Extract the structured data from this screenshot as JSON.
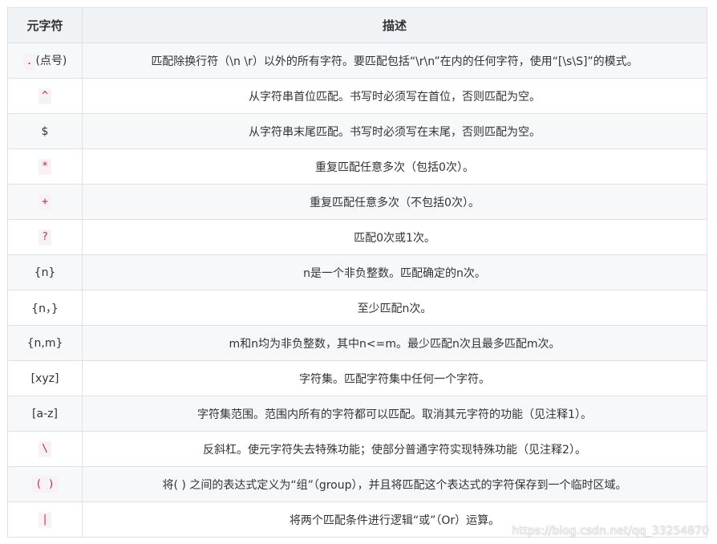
{
  "headers": {
    "col1": "元字符",
    "col2": "描述"
  },
  "rows": [
    {
      "symbol": ".",
      "symbol_suffix": "(点号)",
      "style": "code",
      "desc": "匹配除换行符（\\n \\r）以外的所有字符。要匹配包括“\\r\\n”在内的任何字符，使用“[\\s\\S]”的模式。"
    },
    {
      "symbol": "^",
      "symbol_suffix": "",
      "style": "code",
      "desc": "从字符串首位匹配。书写时必须写在首位，否则匹配为空。"
    },
    {
      "symbol": "$",
      "symbol_suffix": "",
      "style": "plain",
      "desc": "从字符串末尾匹配。书写时必须写在末尾，否则匹配为空。"
    },
    {
      "symbol": "*",
      "symbol_suffix": "",
      "style": "code",
      "desc": "重复匹配任意多次（包括0次）。"
    },
    {
      "symbol": "+",
      "symbol_suffix": "",
      "style": "code",
      "desc": "重复匹配任意多次（不包括0次）。"
    },
    {
      "symbol": "?",
      "symbol_suffix": "",
      "style": "code",
      "desc": "匹配0次或1次。"
    },
    {
      "symbol": "{n}",
      "symbol_suffix": "",
      "style": "plain",
      "desc": "n是一个非负整数。匹配确定的n次。"
    },
    {
      "symbol": "{n，}",
      "symbol_suffix": "",
      "style": "plain",
      "desc": "至少匹配n次。"
    },
    {
      "symbol": "{n,m}",
      "symbol_suffix": "",
      "style": "plain",
      "desc": "m和n均为非负整数，其中n<=m。最少匹配n次且最多匹配m次。"
    },
    {
      "symbol": "[xyz]",
      "symbol_suffix": "",
      "style": "plain",
      "desc": "字符集。匹配字符集中任何一个字符。"
    },
    {
      "symbol": "[a-z]",
      "symbol_suffix": "",
      "style": "plain",
      "desc": "字符集范围。范围内所有的字符都可以匹配。取消其元字符的功能（见注释1）。"
    },
    {
      "symbol": "\\",
      "symbol_suffix": "",
      "style": "code",
      "desc": "反斜杠。使元字符失去特殊功能；使部分普通字符实现特殊功能（见注释2）。"
    },
    {
      "symbol": "( )",
      "symbol_suffix": "",
      "style": "code",
      "desc": "将( ) 之间的表达式定义为“组”（group），并且将匹配这个表达式的字符保存到一个临时区域。"
    },
    {
      "symbol": "|",
      "symbol_suffix": "",
      "style": "code",
      "desc": "将两个匹配条件进行逻辑“或”（Or）运算。"
    }
  ],
  "watermark": "https://blog.csdn.net/qq_33254870"
}
